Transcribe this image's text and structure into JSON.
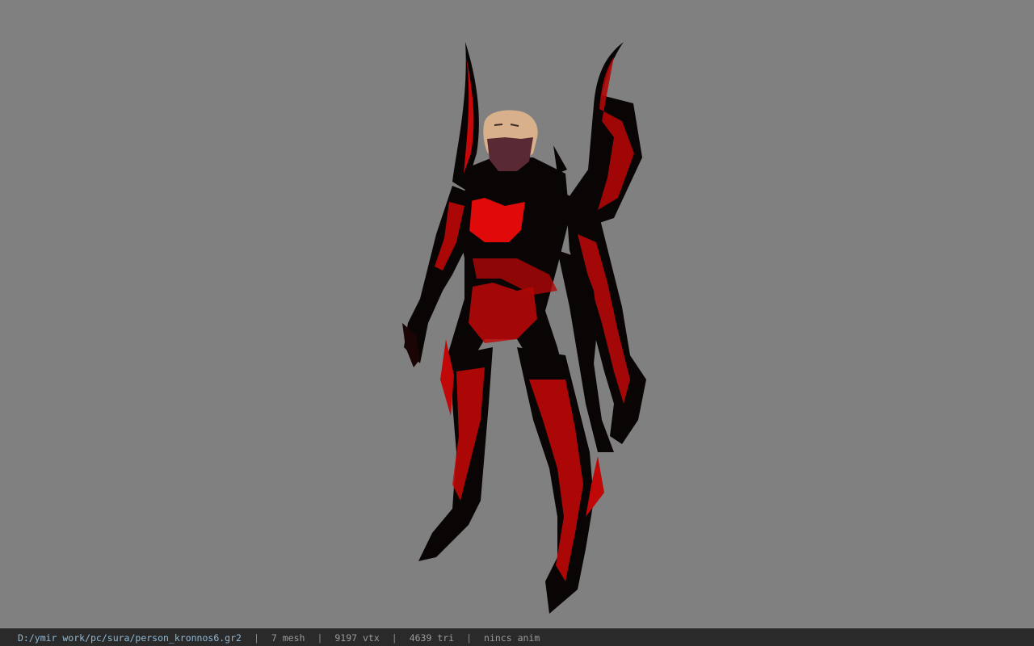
{
  "viewport": {
    "background_color": "#808080",
    "model_primary_color": "#0a0505",
    "model_accent_color": "#e00a0a",
    "model_skin_color": "#d9b08c",
    "model_mask_color": "#5a2a34"
  },
  "status_bar": {
    "file_path": "D:/ymir work/pc/sura/person_kronnos6.gr2",
    "separator": "|",
    "mesh_count": "7 mesh",
    "vertex_count": "9197 vtx",
    "triangle_count": "4639 tri",
    "anim_info": "nincs anim"
  }
}
